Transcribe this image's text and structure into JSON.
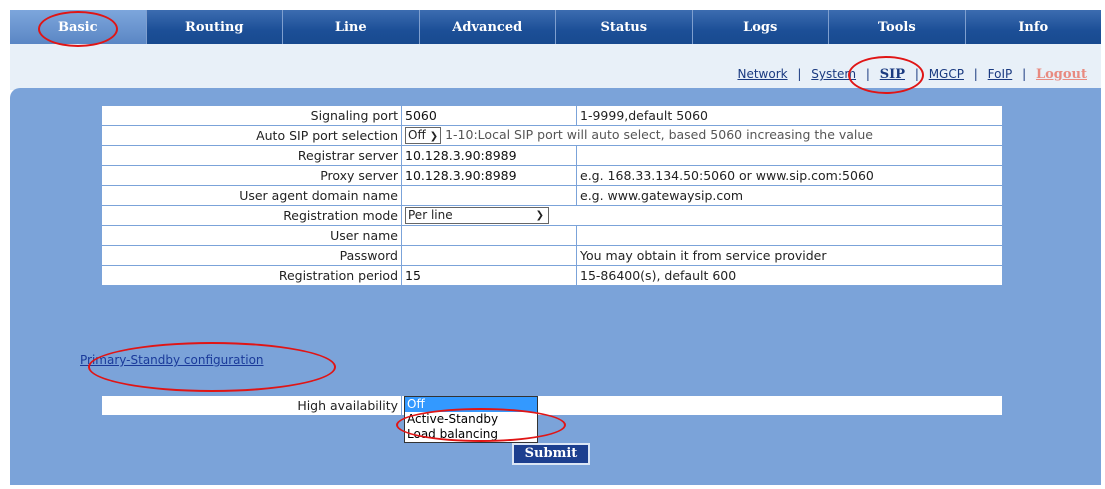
{
  "tabs": [
    "Basic",
    "Routing",
    "Line",
    "Advanced",
    "Status",
    "Logs",
    "Tools",
    "Info"
  ],
  "subnav": {
    "network": "Network",
    "system": "System",
    "sip": "SIP",
    "mgcp": "MGCP",
    "foip": "FoIP",
    "logout": "Logout",
    "separator": "|"
  },
  "form": {
    "signaling_port": {
      "label": "Signaling port",
      "value": "5060",
      "hint": "1-9999,default 5060"
    },
    "auto_sip": {
      "label": "Auto SIP port selection",
      "value": "Off",
      "hint": "1-10:Local SIP port will auto select, based 5060 increasing the value"
    },
    "registrar": {
      "label": "Registrar server",
      "value": "10.128.3.90:8989",
      "hint": ""
    },
    "proxy": {
      "label": "Proxy server",
      "value": "10.128.3.90:8989",
      "hint": "e.g. 168.33.134.50:5060 or www.sip.com:5060"
    },
    "ua_domain": {
      "label": "User agent domain name",
      "value": "",
      "hint": "e.g. www.gatewaysip.com"
    },
    "reg_mode": {
      "label": "Registration mode",
      "value": "Per line",
      "hint": ""
    },
    "username": {
      "label": "User name",
      "value": "",
      "hint": ""
    },
    "password": {
      "label": "Password",
      "value": "",
      "hint": "You may obtain it from service provider"
    },
    "reg_period": {
      "label": "Registration period",
      "value": "15",
      "hint": "15-86400(s), default 600"
    }
  },
  "primary_standby_link": "Primary-Standby configuration",
  "ha": {
    "label": "High availability",
    "options": [
      "Off",
      "Active-Standby",
      "Load balancing"
    ],
    "highlighted": "Off"
  },
  "submit_label": "Submit",
  "colors": {
    "annotation": "#e01515",
    "tabbar": "#1c4f97",
    "panel": "#7ba3d9"
  }
}
